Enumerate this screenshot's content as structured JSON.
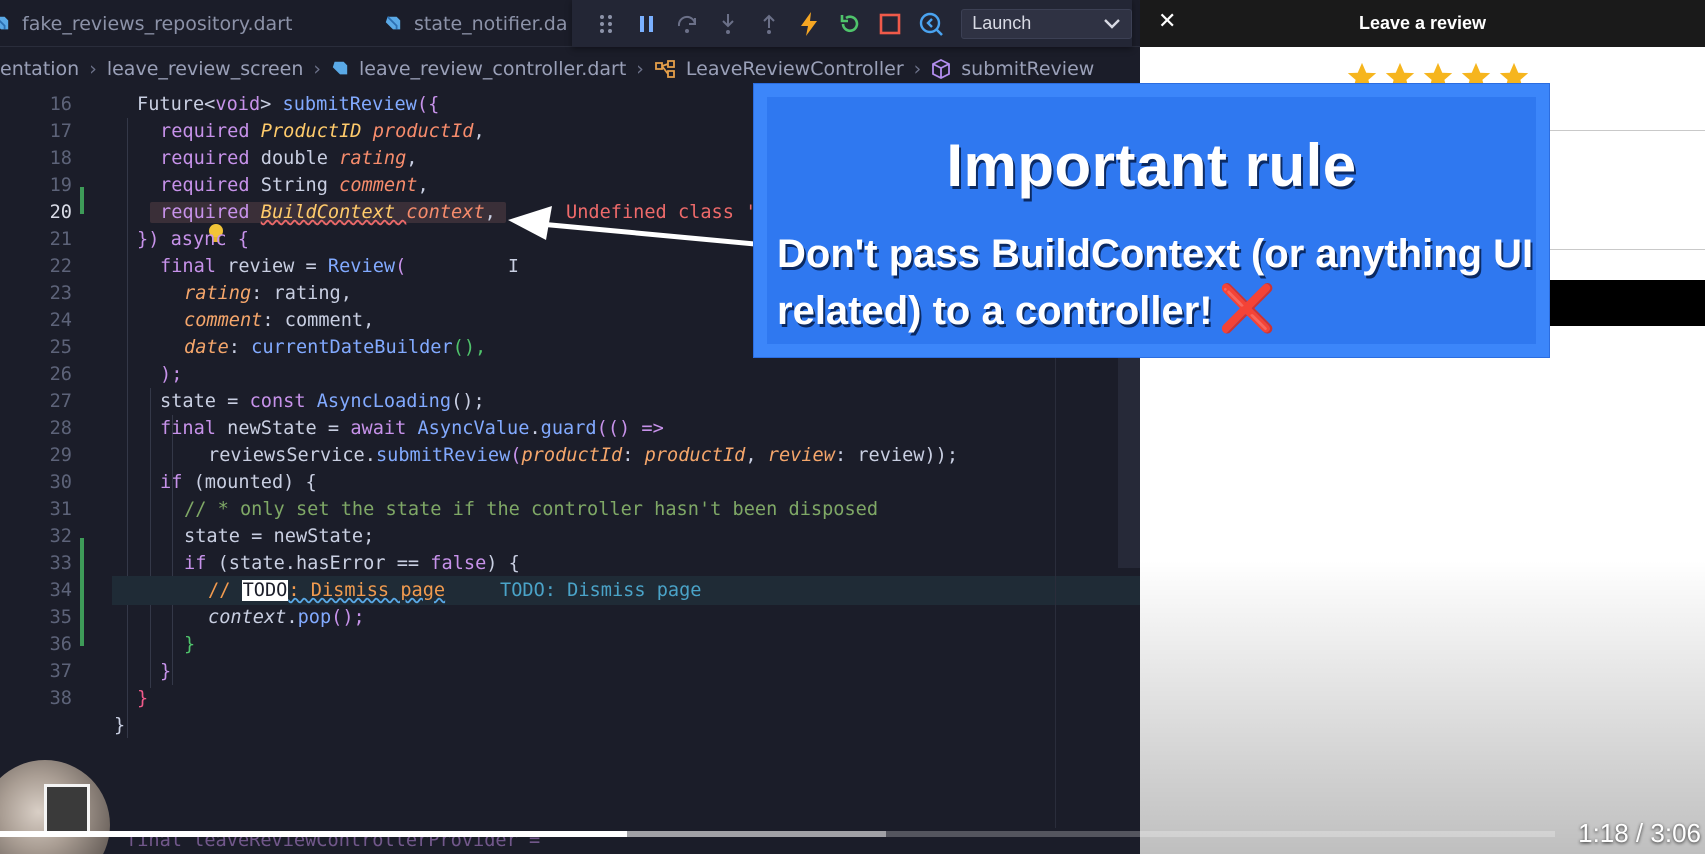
{
  "tabs": [
    {
      "label": "fake_reviews_repository.dart"
    },
    {
      "label": "state_notifier.da"
    }
  ],
  "debug_toolbar": {
    "icons": [
      "drag-grip",
      "pause",
      "step-over",
      "step-into",
      "step-out",
      "hot-reload",
      "hot-restart",
      "stop",
      "devtools"
    ],
    "launch_label": "Launch"
  },
  "breadcrumb": [
    "entation",
    "leave_review_screen",
    "leave_review_controller.dart",
    "LeaveReviewController",
    "submitReview"
  ],
  "code": {
    "line_numbers": [
      "16",
      "17",
      "18",
      "19",
      "20",
      "21",
      "22",
      "23",
      "24",
      "25",
      "26",
      "27",
      "28",
      "29",
      "30",
      "31",
      "32",
      "33",
      "34",
      "35",
      "36",
      "37",
      "38",
      ""
    ],
    "active_line": "20",
    "l16": {
      "a": "Future<",
      "b": "void",
      "c": "> ",
      "d": "submitReview",
      "e": "({"
    },
    "l17": {
      "kw": "required ",
      "ty": "ProductID ",
      "par": "productId",
      "end": ","
    },
    "l18": {
      "kw": "required ",
      "ty": "double ",
      "par": "rating",
      "end": ","
    },
    "l19": {
      "kw": "required ",
      "ty": "String ",
      "par": "comment",
      "end": ","
    },
    "l20": {
      "kw": "required ",
      "ty": "BuildContext ",
      "par": "context",
      "end": ",",
      "error": "Undefined class 'B"
    },
    "l21": {
      "a": "}) ",
      "b": "async",
      "c": " {"
    },
    "l22": {
      "a": "final ",
      "b": "review = ",
      "c": "Review",
      "d": "("
    },
    "l23": {
      "a": "rating",
      "b": ": rating,"
    },
    "l24": {
      "a": "comment",
      "b": ": comment,"
    },
    "l25": {
      "a": "date",
      "b": ": ",
      "c": "currentDateBuilder",
      "d": "(),"
    },
    "l26": {
      "a": ");"
    },
    "l27": {
      "a": "state = ",
      "b": "const ",
      "c": "AsyncLoading",
      "d": "();"
    },
    "l28": {
      "a": "final ",
      "b": "newState = ",
      "c": "await ",
      "d": "AsyncValue",
      "e": ".",
      "f": "guard",
      "g": "(() =>"
    },
    "l29": {
      "a": "reviewsService",
      "b": ".",
      "c": "submitReview",
      "d": "(",
      "e": "productId",
      "f": ": ",
      "g": "productId",
      "h": ", ",
      "i": "review",
      "j": ": review));"
    },
    "l30": {
      "a": "if ",
      "b": "(mounted) {"
    },
    "l31": {
      "a": "// * only set the state if the controller hasn't been disposed"
    },
    "l32": {
      "a": "state = newState;"
    },
    "l33": {
      "a": "if ",
      "b": "(state.hasError == ",
      "c": "false",
      "d": ") {"
    },
    "l34": {
      "a": "// ",
      "b": "TODO",
      "c": ": Dismiss page",
      "hint": "TODO: Dismiss page"
    },
    "l35": {
      "a": "context",
      "b": ".",
      "c": "pop",
      "d": "();"
    },
    "l36": {
      "a": "}"
    },
    "l37": {
      "a": "}"
    },
    "l38": {
      "a": "}"
    },
    "l39": {
      "a": "}"
    },
    "l40": {
      "a": "final leaveReviewControllerProvider ="
    }
  },
  "app": {
    "close_icon": "close-icon",
    "title": "Leave a review",
    "star_count": 5,
    "star_color": "#f6b51e"
  },
  "annotation": {
    "title": "Important rule",
    "body": "Don't pass BuildContext (or anything UI related) to a controller!",
    "x_mark": "❌"
  },
  "video": {
    "time": "1:18 / 3:06",
    "played_fraction": 0.403,
    "buffered_fraction": 0.57
  },
  "colors": {
    "editor_bg": "#1b1d29",
    "annotation_bg": "#2f78f0",
    "keyword": "#c792ea",
    "function": "#82aaff",
    "type": "#ffcb6b",
    "parameter": "#f78c6c",
    "comment": "#7fa866",
    "error": "#ee6a6a"
  }
}
